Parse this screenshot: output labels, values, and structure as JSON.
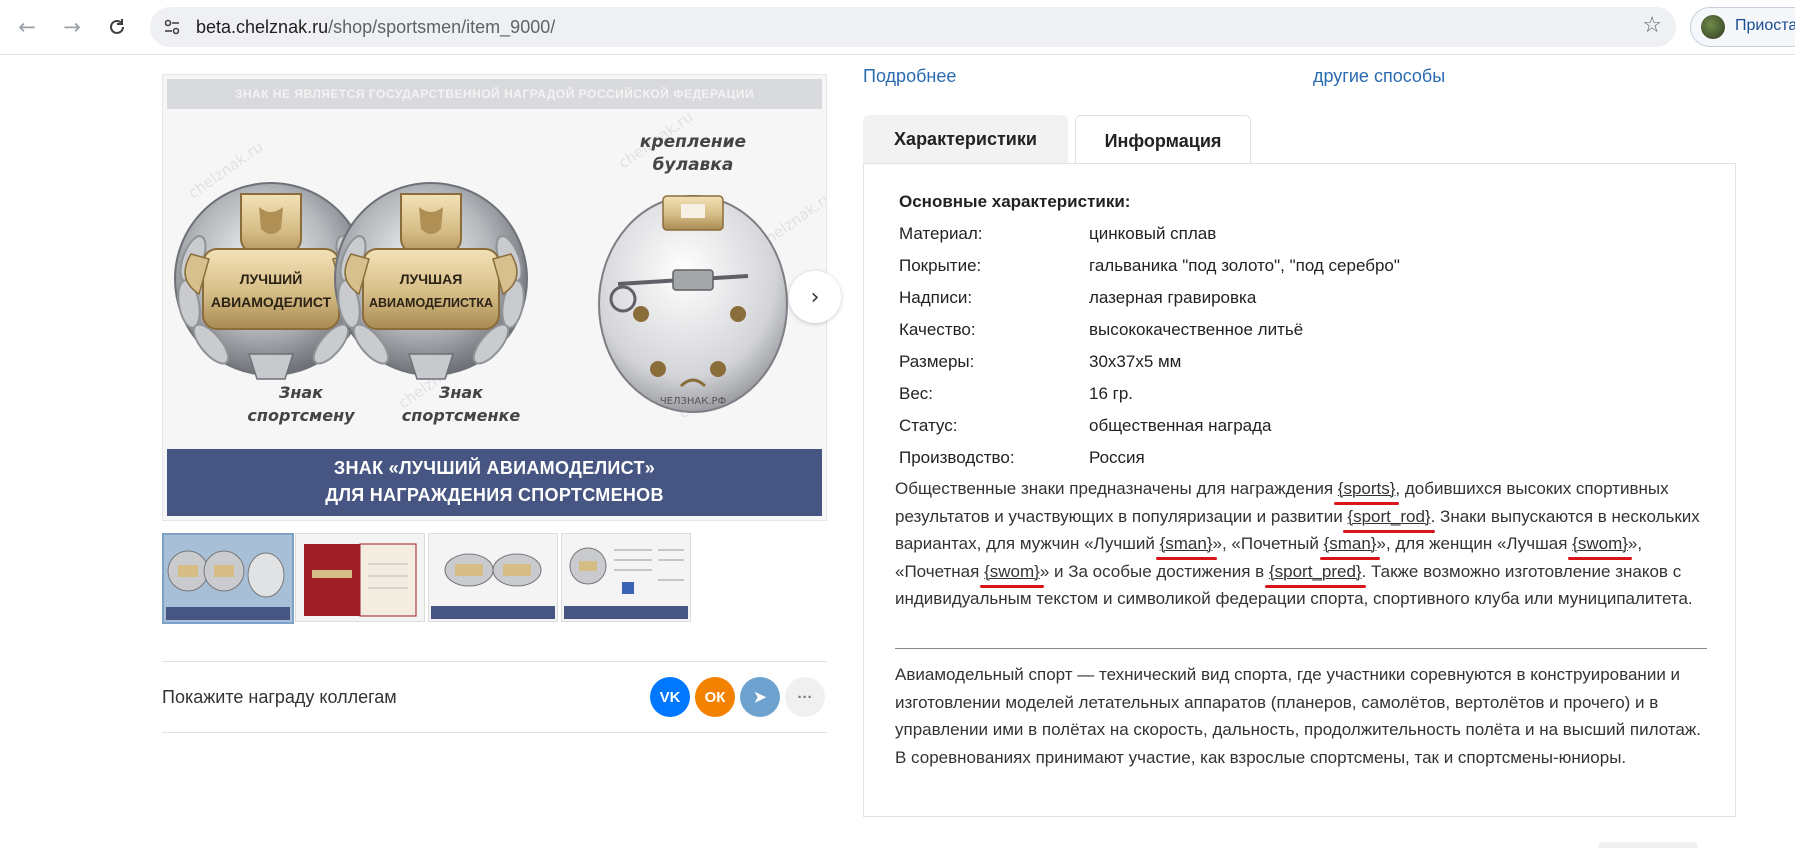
{
  "browser": {
    "url_host": "beta.chelznak.ru",
    "url_path": "/shop/sportsmen/item_9000/",
    "profile_name": "Приостан"
  },
  "links": {
    "more": "Подробнее",
    "other_ways": "другие способы"
  },
  "gallery": {
    "top_banner": "ЗНАК НЕ ЯВЛЯЕТСЯ ГОСУДАРСТВЕННОЙ НАГРАДОЙ РОССИЙСКОЙ ФЕДЕРАЦИИ",
    "badge1_text": [
      "ЛУЧШИЙ",
      "АВИАМОДЕЛИСТ"
    ],
    "badge2_text": [
      "ЛУЧШАЯ",
      "АВИАМОДЕЛИСТКА"
    ],
    "caption1": [
      "Знак",
      "спортсмену"
    ],
    "caption2": [
      "Знак",
      "спортсменке"
    ],
    "pin_caption": [
      "крепление",
      "булавка"
    ],
    "watermark": "chelznak.ru",
    "pin_mark": "ЧЕЛЗНАК.РФ",
    "footer": [
      "ЗНАК «ЛУЧШИЙ АВИАМОДЕЛИСТ»",
      "ДЛЯ НАГРАЖДЕНИЯ СПОРТСМЕНОВ"
    ]
  },
  "share": {
    "label": "Покажите награду коллегам",
    "buttons": [
      {
        "name": "vk",
        "glyph": "VK",
        "color": "#0077ff"
      },
      {
        "name": "ok",
        "glyph": "ОК",
        "color": "#f38200"
      },
      {
        "name": "telegram",
        "glyph": "➤",
        "color": "#6ea3cf"
      },
      {
        "name": "more",
        "glyph": "···",
        "color": "#f0f0f0"
      }
    ]
  },
  "tabs": [
    {
      "label": "Характеристики",
      "active": false
    },
    {
      "label": "Информация",
      "active": true
    }
  ],
  "specs": {
    "title": "Основные характеристики:",
    "rows": [
      {
        "label": "Материал:",
        "value": "цинковый сплав"
      },
      {
        "label": "Покрытие:",
        "value": "гальваника \"под золото\", \"под серебро\""
      },
      {
        "label": "Надписи:",
        "value": "лазерная гравировка"
      },
      {
        "label": "Качество:",
        "value": "высококачественное литьё"
      },
      {
        "label": "Размеры:",
        "value": "30х37х5 мм"
      },
      {
        "label": "Вес:",
        "value": "16 гр."
      },
      {
        "label": "Статус:",
        "value": "общественная награда"
      },
      {
        "label": "Производство:",
        "value": "Россия"
      }
    ]
  },
  "description": {
    "p1": "Общественные знаки предназначены для награждения ",
    "ph_sports": "{sports}",
    "p2": ", добившихся высоких спортивных результатов и участвующих в популяризации и развитии ",
    "ph_sport_rod": "{sport_rod}",
    "p3": ". Знаки выпускаются в нескольких вариантах, для мужчин «Лучший ",
    "ph_sman1": "{sman}",
    "p4": "», «Почетный ",
    "ph_sman2": "{sman}",
    "p5": "», для женщин «Лучшая ",
    "ph_swom1": "{swom}",
    "p6": "», «Почетная ",
    "ph_swom2": "{swom}",
    "p7": "» и За особые достижения в ",
    "ph_sport_pred": "{sport_pred}",
    "p8": ". Также возможно изготовление знаков с индивидуальным текстом и символикой федерации спорта, спортивного клуба или муниципалитета.",
    "about": "Авиамодельный спорт — технический вид спорта, где участники соревнуются в конструировании и изготовлении моделей летательных аппаратов (планеров, самолётов, вертолётов и прочего) и в управлении ими в полётах на скорость, дальность, продолжительность полёта и на высший пилотаж. В соревнованиях принимают участие, как взрослые спортсмены, так и спортсмены-юниоры."
  }
}
